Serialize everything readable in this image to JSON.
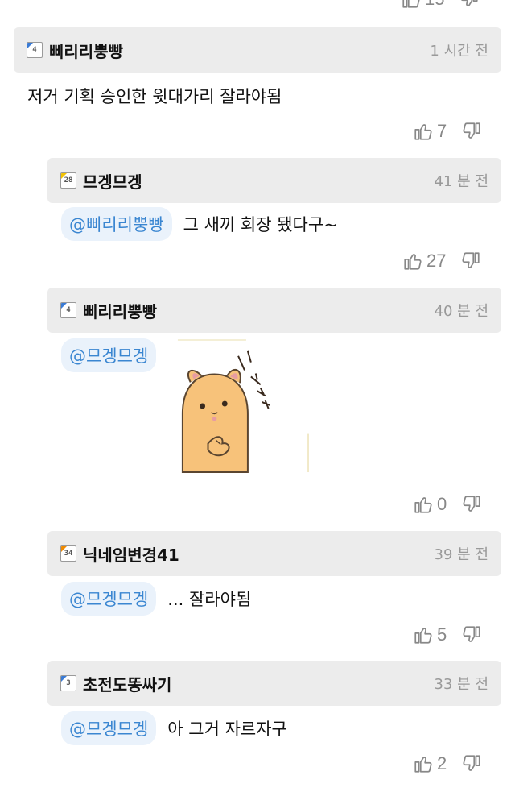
{
  "top_partial": {
    "count": "15"
  },
  "comments": [
    {
      "level": "4",
      "level_color": "#3a7bd5",
      "nick": "삐리리뿡빵",
      "time": "1 시간 전",
      "text": "저거 기획 승인한 윗대가리 잘라야됨",
      "likes": "7"
    },
    {
      "level": "28",
      "level_color": "#f2c200",
      "nick": "므겡므겡",
      "time": "41 분 전",
      "mention": "@삐리리뿡빵",
      "text": "그 새끼 회장 됐다구~",
      "likes": "27"
    },
    {
      "level": "4",
      "level_color": "#3a7bd5",
      "nick": "삐리리뿡빵",
      "time": "40 분 전",
      "mention": "@므겡므겡",
      "image": "hamster-sticker",
      "likes": "0"
    },
    {
      "level": "34",
      "level_color": "#f08a00",
      "nick": "닉네임변경41",
      "time": "39 분 전",
      "mention": "@므겡므겡",
      "text": "... 잘라야됨",
      "likes": "5"
    },
    {
      "level": "3",
      "level_color": "#3a7bd5",
      "nick": "초전도똥싸기",
      "time": "33 분 전",
      "mention": "@므겡므겡",
      "text": "아 그거 자르자구",
      "likes": "2"
    }
  ]
}
